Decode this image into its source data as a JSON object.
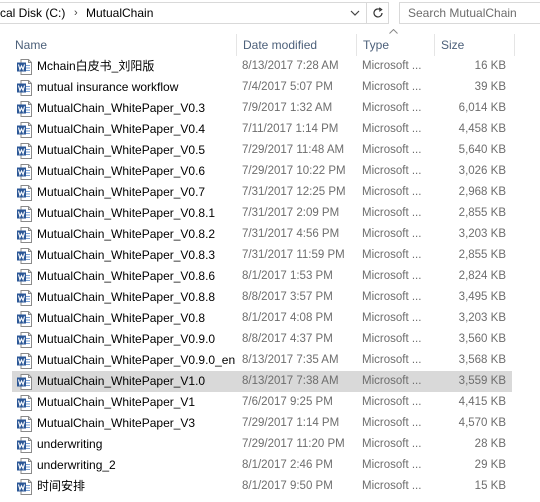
{
  "address_bar": {
    "crumbs": [
      "cal Disk (C:)",
      "MutualChain"
    ],
    "separator": "›",
    "dropdown_icon": "chevron-down-icon",
    "refresh_icon": "refresh-icon"
  },
  "search": {
    "placeholder": "Search MutualChain"
  },
  "columns": {
    "name": "Name",
    "date": "Date modified",
    "type": "Type",
    "size": "Size",
    "sort": "Type ascending"
  },
  "colors": {
    "accent": "#2b5797",
    "header_text": "#4c607a",
    "selected": "#d9d9d9"
  },
  "files": [
    {
      "name": "Mchain白皮书_刘阳版",
      "date": "8/13/2017 7:28 AM",
      "type": "Microsoft ...",
      "size": "16 KB"
    },
    {
      "name": "mutual insurance workflow",
      "date": "7/4/2017 5:07 PM",
      "type": "Microsoft ...",
      "size": "39 KB"
    },
    {
      "name": "MutualChain_WhitePaper_V0.3",
      "date": "7/9/2017 1:32 AM",
      "type": "Microsoft ...",
      "size": "6,014 KB"
    },
    {
      "name": "MutualChain_WhitePaper_V0.4",
      "date": "7/11/2017 1:14 PM",
      "type": "Microsoft ...",
      "size": "4,458 KB"
    },
    {
      "name": "MutualChain_WhitePaper_V0.5",
      "date": "7/29/2017 11:48 AM",
      "type": "Microsoft ...",
      "size": "5,640 KB"
    },
    {
      "name": "MutualChain_WhitePaper_V0.6",
      "date": "7/29/2017 10:22 PM",
      "type": "Microsoft ...",
      "size": "3,026 KB"
    },
    {
      "name": "MutualChain_WhitePaper_V0.7",
      "date": "7/31/2017 12:25 PM",
      "type": "Microsoft ...",
      "size": "2,968 KB"
    },
    {
      "name": "MutualChain_WhitePaper_V0.8.1",
      "date": "7/31/2017 2:09 PM",
      "type": "Microsoft ...",
      "size": "2,855 KB"
    },
    {
      "name": "MutualChain_WhitePaper_V0.8.2",
      "date": "7/31/2017 4:56 PM",
      "type": "Microsoft ...",
      "size": "3,203 KB"
    },
    {
      "name": "MutualChain_WhitePaper_V0.8.3",
      "date": "7/31/2017 11:59 PM",
      "type": "Microsoft ...",
      "size": "2,855 KB"
    },
    {
      "name": "MutualChain_WhitePaper_V0.8.6",
      "date": "8/1/2017 1:53 PM",
      "type": "Microsoft ...",
      "size": "2,824 KB"
    },
    {
      "name": "MutualChain_WhitePaper_V0.8.8",
      "date": "8/8/2017 3:57 PM",
      "type": "Microsoft ...",
      "size": "3,495 KB"
    },
    {
      "name": "MutualChain_WhitePaper_V0.8",
      "date": "8/1/2017 4:08 PM",
      "type": "Microsoft ...",
      "size": "3,203 KB"
    },
    {
      "name": "MutualChain_WhitePaper_V0.9.0",
      "date": "8/8/2017 4:37 PM",
      "type": "Microsoft ...",
      "size": "3,560 KB"
    },
    {
      "name": "MutualChain_WhitePaper_V0.9.0_en",
      "date": "8/13/2017 7:35 AM",
      "type": "Microsoft ...",
      "size": "3,568 KB"
    },
    {
      "name": "MutualChain_WhitePaper_V1.0",
      "date": "8/13/2017 7:38 AM",
      "type": "Microsoft ...",
      "size": "3,559 KB",
      "selected": true
    },
    {
      "name": "MutualChain_WhitePaper_V1",
      "date": "7/6/2017 9:25 PM",
      "type": "Microsoft ...",
      "size": "4,415 KB"
    },
    {
      "name": "MutualChain_WhitePaper_V3",
      "date": "7/29/2017 1:14 PM",
      "type": "Microsoft ...",
      "size": "4,570 KB"
    },
    {
      "name": "underwriting",
      "date": "7/29/2017 11:20 PM",
      "type": "Microsoft ...",
      "size": "28 KB"
    },
    {
      "name": "underwriting_2",
      "date": "8/1/2017 2:46 PM",
      "type": "Microsoft ...",
      "size": "29 KB"
    },
    {
      "name": "时间安排",
      "date": "8/1/2017 9:50 PM",
      "type": "Microsoft ...",
      "size": "15 KB"
    }
  ],
  "file_icon": "word-document-icon"
}
